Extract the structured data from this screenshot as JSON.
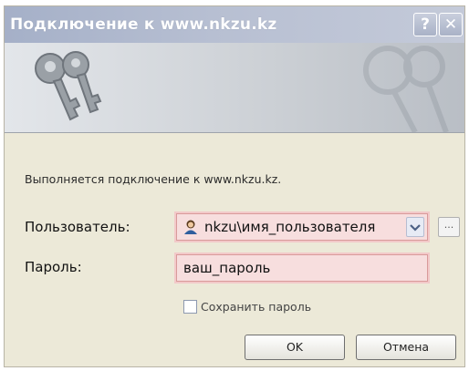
{
  "window": {
    "title": "Подключение к www.nkzu.kz",
    "help_glyph": "?",
    "close_glyph": "✕"
  },
  "banner": {
    "icon": "keys-icon"
  },
  "message": "Выполняется подключение к www.nkzu.kz.",
  "form": {
    "user_label": "Пользователь:",
    "user_value": "nkzu\\имя_пользователя",
    "user_icon": "user-icon",
    "browse_label": "...",
    "password_label": "Пароль:",
    "password_value": "ваш_пароль",
    "save_password_label": "Сохранить пароль",
    "save_password_checked": false
  },
  "buttons": {
    "ok": "OK",
    "cancel": "Отмена"
  },
  "colors": {
    "titlebar": "#a5b0c8",
    "highlight_fill": "#f7dede",
    "highlight_border": "#d99a9a",
    "dialog_bg": "#ece9d8"
  }
}
